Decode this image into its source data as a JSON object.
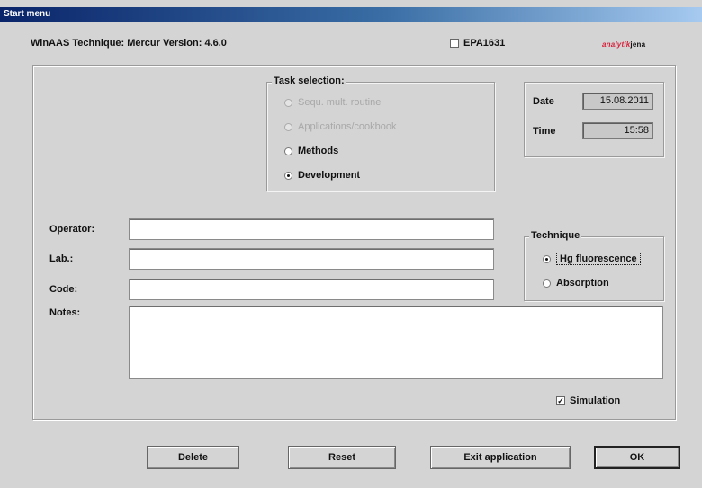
{
  "window": {
    "title": "Start menu"
  },
  "header": {
    "app_info": "WinAAS Technique: Mercur   Version: 4.6.0",
    "epa_label": "EPA1631",
    "epa_checked": false,
    "logo_prefix": "analytik",
    "logo_suffix": "jena"
  },
  "task_selection": {
    "title": "Task selection:",
    "options": [
      {
        "label": "Sequ. mult. routine",
        "checked": false,
        "enabled": false
      },
      {
        "label": "Applications/cookbook",
        "checked": false,
        "enabled": false
      },
      {
        "label": "Methods",
        "checked": false,
        "enabled": true
      },
      {
        "label": "Development",
        "checked": true,
        "enabled": true
      }
    ]
  },
  "datetime": {
    "date_label": "Date",
    "date_value": "15.08.2011",
    "time_label": "Time",
    "time_value": "15:58"
  },
  "form": {
    "operator_label": "Operator:",
    "operator_value": "",
    "lab_label": "Lab.:",
    "lab_value": "",
    "code_label": "Code:",
    "code_value": "",
    "notes_label": "Notes:",
    "notes_value": ""
  },
  "technique": {
    "title": "Technique",
    "options": [
      {
        "label": "Hg fluorescence",
        "checked": true
      },
      {
        "label": "Absorption",
        "checked": false
      }
    ]
  },
  "simulation": {
    "label": "Simulation",
    "checked": true
  },
  "buttons": {
    "delete": "Delete",
    "reset": "Reset",
    "exit": "Exit application",
    "ok": "OK"
  }
}
